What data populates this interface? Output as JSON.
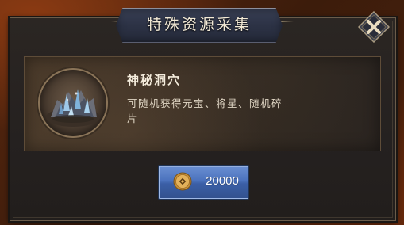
{
  "dialog": {
    "title": "特殊资源采集",
    "close_icon": "close-x-icon"
  },
  "resource": {
    "icon": "mysterious-cave-icon",
    "name": "神秘洞穴",
    "description": "可随机获得元宝、将星、随机碎片"
  },
  "cost": {
    "currency_icon": "copper-coin-icon",
    "amount": "20000"
  },
  "colors": {
    "panel_bg": "#252120",
    "banner_bg": "#2c3245",
    "button_blue": "#4b72bd",
    "text_light": "#f4ecdc"
  }
}
